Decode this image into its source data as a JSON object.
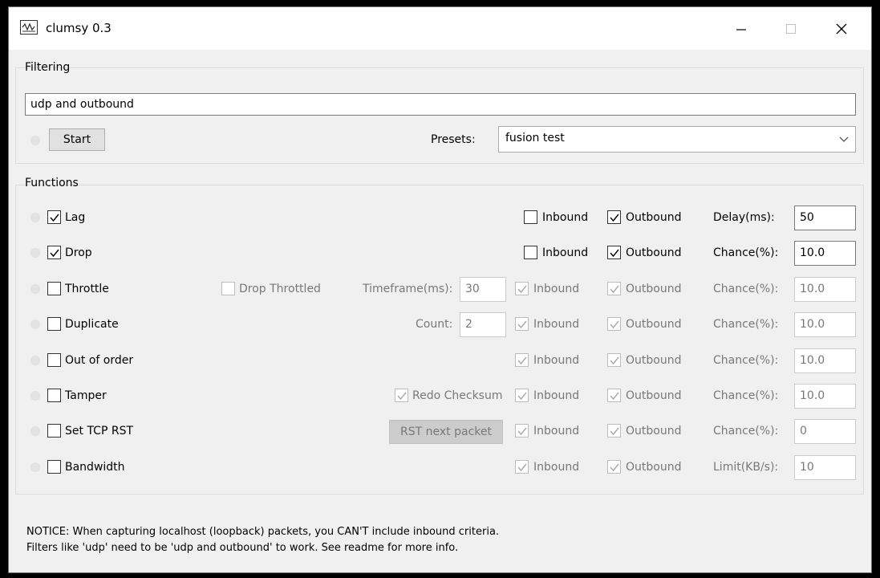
{
  "window": {
    "title": "clumsy 0.3"
  },
  "filtering": {
    "title": "Filtering",
    "filter_value": "udp and outbound",
    "start_label": "Start",
    "presets_label": "Presets:",
    "preset_selected": "fusion test"
  },
  "functions": {
    "title": "Functions",
    "rows": [
      {
        "name": "Lag",
        "checked": true,
        "inbound_label": "Inbound",
        "inbound_checked": false,
        "outbound_label": "Outbound",
        "outbound_checked": true,
        "param_label": "Delay(ms):",
        "param_value": "50",
        "enabled": true
      },
      {
        "name": "Drop",
        "checked": true,
        "inbound_label": "Inbound",
        "inbound_checked": false,
        "outbound_label": "Outbound",
        "outbound_checked": true,
        "param_label": "Chance(%):",
        "param_value": "10.0",
        "enabled": true
      },
      {
        "name": "Throttle",
        "checked": false,
        "extra_check_label": "Drop Throttled",
        "extra_field_label": "Timeframe(ms):",
        "extra_field_value": "30",
        "inbound_label": "Inbound",
        "inbound_checked": true,
        "outbound_label": "Outbound",
        "outbound_checked": true,
        "param_label": "Chance(%):",
        "param_value": "10.0",
        "enabled": false
      },
      {
        "name": "Duplicate",
        "checked": false,
        "extra_field_label": "Count:",
        "extra_field_value": "2",
        "inbound_label": "Inbound",
        "inbound_checked": true,
        "outbound_label": "Outbound",
        "outbound_checked": true,
        "param_label": "Chance(%):",
        "param_value": "10.0",
        "enabled": false
      },
      {
        "name": "Out of order",
        "checked": false,
        "inbound_label": "Inbound",
        "inbound_checked": true,
        "outbound_label": "Outbound",
        "outbound_checked": true,
        "param_label": "Chance(%):",
        "param_value": "10.0",
        "enabled": false
      },
      {
        "name": "Tamper",
        "checked": false,
        "extra_check_label": "Redo Checksum",
        "inbound_label": "Inbound",
        "inbound_checked": true,
        "outbound_label": "Outbound",
        "outbound_checked": true,
        "param_label": "Chance(%):",
        "param_value": "10.0",
        "enabled": false
      },
      {
        "name": "Set TCP RST",
        "checked": false,
        "extra_button_label": "RST next packet",
        "inbound_label": "Inbound",
        "inbound_checked": true,
        "outbound_label": "Outbound",
        "outbound_checked": true,
        "param_label": "Chance(%):",
        "param_value": "0",
        "enabled": false
      },
      {
        "name": "Bandwidth",
        "checked": false,
        "inbound_label": "Inbound",
        "inbound_checked": true,
        "outbound_label": "Outbound",
        "outbound_checked": true,
        "param_label": "Limit(KB/s):",
        "param_value": "10",
        "enabled": false
      }
    ]
  },
  "notice": {
    "line1": "NOTICE: When capturing localhost (loopback) packets, you CAN'T include inbound criteria.",
    "line2": "Filters like 'udp' need to be 'udp and outbound' to work. See readme for more info."
  }
}
